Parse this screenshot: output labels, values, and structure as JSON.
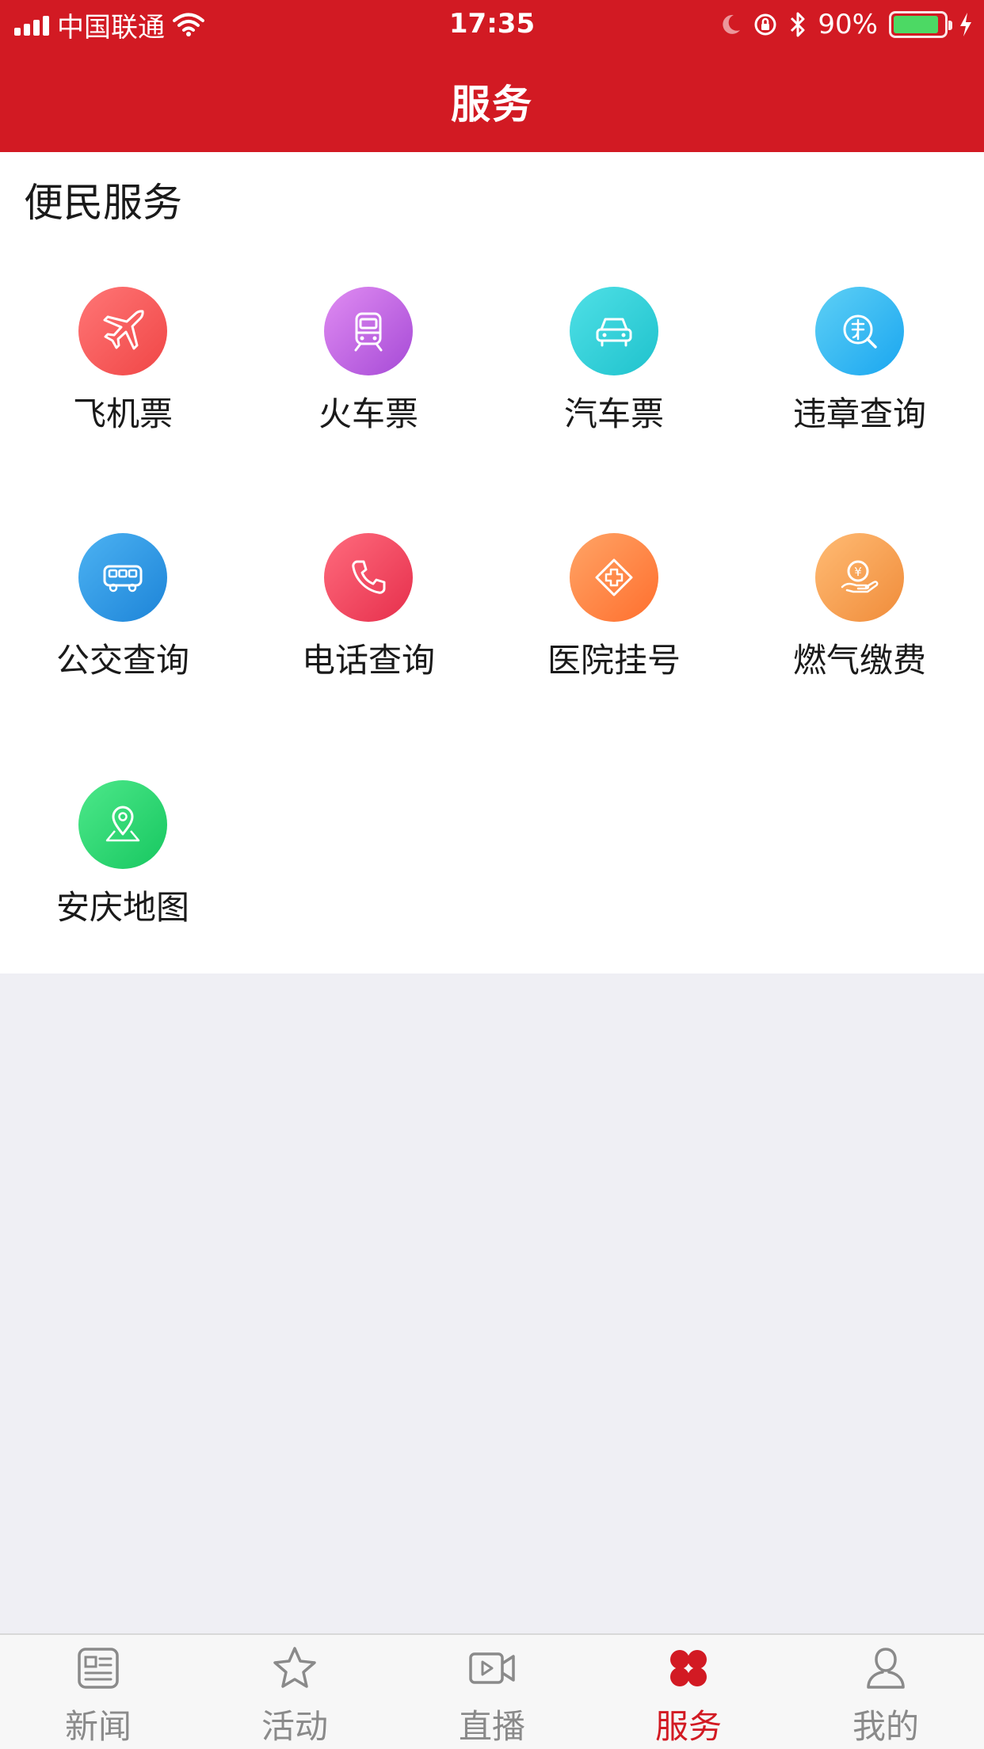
{
  "status_bar": {
    "carrier": "中国联通",
    "time": "17:35",
    "battery_percent": "90%",
    "battery_level": 0.9
  },
  "header": {
    "title": "服务"
  },
  "section": {
    "title": "便民服务"
  },
  "services": [
    {
      "label": "飞机票",
      "icon": "airplane-icon",
      "colors": [
        "#ff7676",
        "#f04646"
      ]
    },
    {
      "label": "火车票",
      "icon": "train-icon",
      "colors": [
        "#e08cf2",
        "#a64ad6"
      ]
    },
    {
      "label": "汽车票",
      "icon": "car-icon",
      "colors": [
        "#4fe0e6",
        "#1fc2cd"
      ]
    },
    {
      "label": "违章查询",
      "icon": "violation-search-icon",
      "colors": [
        "#5ed0f5",
        "#1aa6f0"
      ]
    },
    {
      "label": "公交查询",
      "icon": "bus-icon",
      "colors": [
        "#4cb2f2",
        "#1d84d8"
      ]
    },
    {
      "label": "电话查询",
      "icon": "phone-icon",
      "colors": [
        "#ff6b7d",
        "#e62f4c"
      ]
    },
    {
      "label": "医院挂号",
      "icon": "hospital-icon",
      "colors": [
        "#ffa466",
        "#ff6f2e"
      ]
    },
    {
      "label": "燃气缴费",
      "icon": "gas-payment-icon",
      "colors": [
        "#ffbb74",
        "#f08c3a"
      ]
    },
    {
      "label": "安庆地图",
      "icon": "map-pin-icon",
      "colors": [
        "#4de88a",
        "#17c760"
      ]
    }
  ],
  "tabbar": {
    "items": [
      {
        "label": "新闻",
        "icon": "news-icon"
      },
      {
        "label": "活动",
        "icon": "star-icon"
      },
      {
        "label": "直播",
        "icon": "video-icon"
      },
      {
        "label": "服务",
        "icon": "services-clover-icon"
      },
      {
        "label": "我的",
        "icon": "profile-icon"
      }
    ],
    "active_index": 3,
    "active_color": "#d21a23",
    "inactive_color": "#8a8a8a"
  },
  "colors": {
    "brand": "#d21a23",
    "page_background": "#efeff4"
  }
}
